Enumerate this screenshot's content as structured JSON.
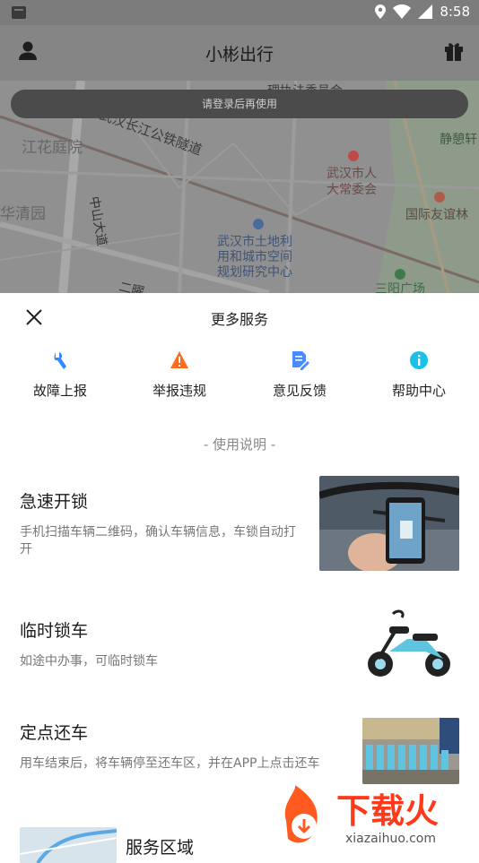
{
  "status_bar": {
    "time": "8:58"
  },
  "header": {
    "title": "小彬出行",
    "user_icon": "user-icon",
    "gift_icon": "gift-icon"
  },
  "map": {
    "login_hint": "请登录后再使用",
    "labels": {
      "l1": "武汉长江公铁隧道",
      "l2": "江花庭院",
      "l3": "华清园",
      "l4": "中山大道",
      "l5": "武汉市人",
      "l6": "大常委会",
      "l7": "武汉市土地利",
      "l8": "用和城市空间",
      "l9": "规划研究中心",
      "l10": "国际友谊林",
      "l11": "静憩轩",
      "l12": "理执法委员会",
      "l13": "三阳广场",
      "l14": "二曜"
    }
  },
  "sheet": {
    "title": "更多服务",
    "services": [
      {
        "label": "故障上报",
        "icon": "wrench-icon",
        "color": "#2f8cff"
      },
      {
        "label": "举报违规",
        "icon": "warning-icon",
        "color": "#ff6b1a"
      },
      {
        "label": "意见反馈",
        "icon": "document-edit-icon",
        "color": "#4a8bff"
      },
      {
        "label": "帮助中心",
        "icon": "info-icon",
        "color": "#19c1e8"
      }
    ],
    "section_title": "- 使用说明 -",
    "items": [
      {
        "title": "急速开锁",
        "desc": "手机扫描车辆二维码，确认车辆信息，车锁自动打开"
      },
      {
        "title": "临时锁车",
        "desc": "如途中办事，可临时锁车"
      },
      {
        "title": "定点还车",
        "desc": "用车结束后，将车辆停至还车区，并在APP上点击还车"
      },
      {
        "title": "服务区域",
        "desc": ""
      }
    ]
  },
  "watermark": {
    "text": "下载火",
    "url": "xiazaihuo.com"
  }
}
